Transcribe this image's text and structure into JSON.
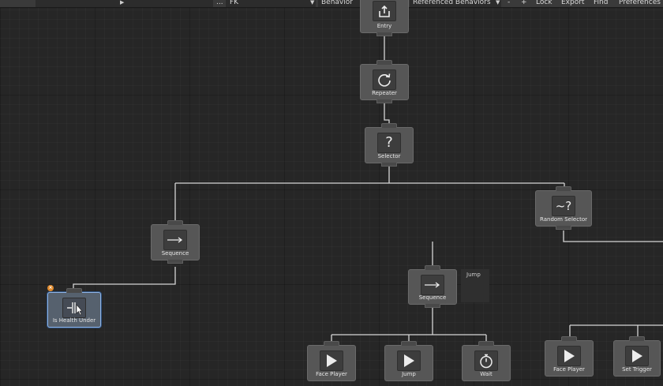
{
  "toolbar": {
    "play_icon": "play-icon",
    "more": "...",
    "fk": "FK",
    "behavior": "Behavior",
    "referenced": "Referenced Behaviors",
    "minus": "-",
    "plus": "+",
    "lock": "Lock",
    "export": "Export",
    "find": "Find",
    "preferences": "Preferences"
  },
  "nodes": {
    "entry": {
      "label": "Entry",
      "icon": "entry-icon"
    },
    "repeater": {
      "label": "Repeater",
      "icon": "repeat-icon"
    },
    "selector": {
      "label": "Selector",
      "icon": "question-icon",
      "glyph": "?"
    },
    "random_selector": {
      "label": "Random Selector",
      "icon": "random-question-icon",
      "glyph": "~?"
    },
    "sequence_left": {
      "label": "Sequence",
      "icon": "arrow-right-icon"
    },
    "sequence_jump": {
      "label": "Sequence",
      "icon": "arrow-right-icon",
      "comment": "Jump"
    },
    "is_health_under": {
      "label": "Is Health Under",
      "icon": "conditional-icon"
    },
    "face_player_1": {
      "label": "Face Player",
      "icon": "play-icon"
    },
    "jump": {
      "label": "Jump",
      "icon": "play-icon"
    },
    "wait": {
      "label": "Wait",
      "icon": "stopwatch-icon"
    },
    "face_player_2": {
      "label": "Face Player",
      "icon": "play-icon"
    },
    "set_trigger": {
      "label": "Set Trigger",
      "icon": "play-icon"
    }
  },
  "colors": {
    "canvas": "#262626",
    "node": "#565656",
    "selected_outline": "#8fb4e6",
    "link": "#d6d6d6",
    "error_badge": "#e08a2c"
  }
}
